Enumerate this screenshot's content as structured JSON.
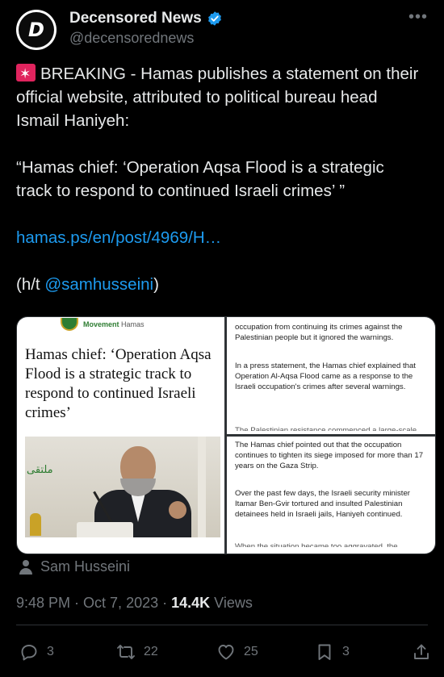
{
  "author": {
    "avatar_letter": "D",
    "display_name": "Decensored News",
    "handle": "@decensorednews"
  },
  "tweet": {
    "line1": "BREAKING - Hamas publishes a statement on their official website, attributed to political bureau head Ismail Haniyeh:",
    "quote": "“Hamas chief: ‘Operation Aqsa Flood is a strategic track to respond to continued Israeli crimes’ ”",
    "link": "hamas.ps/en/post/4969/H…",
    "ht_prefix": "(h/t ",
    "ht_handle": "@samhusseini",
    "ht_suffix": ")"
  },
  "media": {
    "movement_label": "Movement",
    "movement_name": "Hamas",
    "article_title": "Hamas chief: ‘Operation Aqsa Flood is a strategic track to respond to continued Israeli crimes’",
    "photo_sign": "ملتقى",
    "right_top_p1": "occupation from continuing its crimes against the Palestinian people but it ignored the warnings.",
    "right_top_p2": "In a press statement, the Hamas chief explained that Operation Al-Aqsa Flood came as a response to the Israeli occupation's crimes after several warnings.",
    "right_top_p3": "The Palestinian resistance commenced a large-scale",
    "right_bottom_p1": "The Hamas chief pointed out that the occupation continues to tighten its siege imposed for more than 17 years on the Gaza Strip.",
    "right_bottom_p2": "Over the past few days, the Israeli security minister Itamar Ben-Gvir tortured and insulted Palestinian detainees held in Israeli jails, Haniyeh continued.",
    "right_bottom_p3": "When the situation became too aggravated, the"
  },
  "attribution": {
    "name": "Sam Husseini"
  },
  "meta": {
    "time": "9:48 PM",
    "sep1": " · ",
    "date": "Oct 7, 2023",
    "sep2": " · ",
    "views_count": "14.4K",
    "views_label": " Views"
  },
  "actions": {
    "replies": "3",
    "retweets": "22",
    "likes": "25",
    "bookmarks": "3"
  },
  "colors": {
    "background": "#000000",
    "text": "#e7e9ea",
    "muted": "#71767b",
    "link": "#1d9bf0",
    "verified": "#1d9bf0"
  }
}
